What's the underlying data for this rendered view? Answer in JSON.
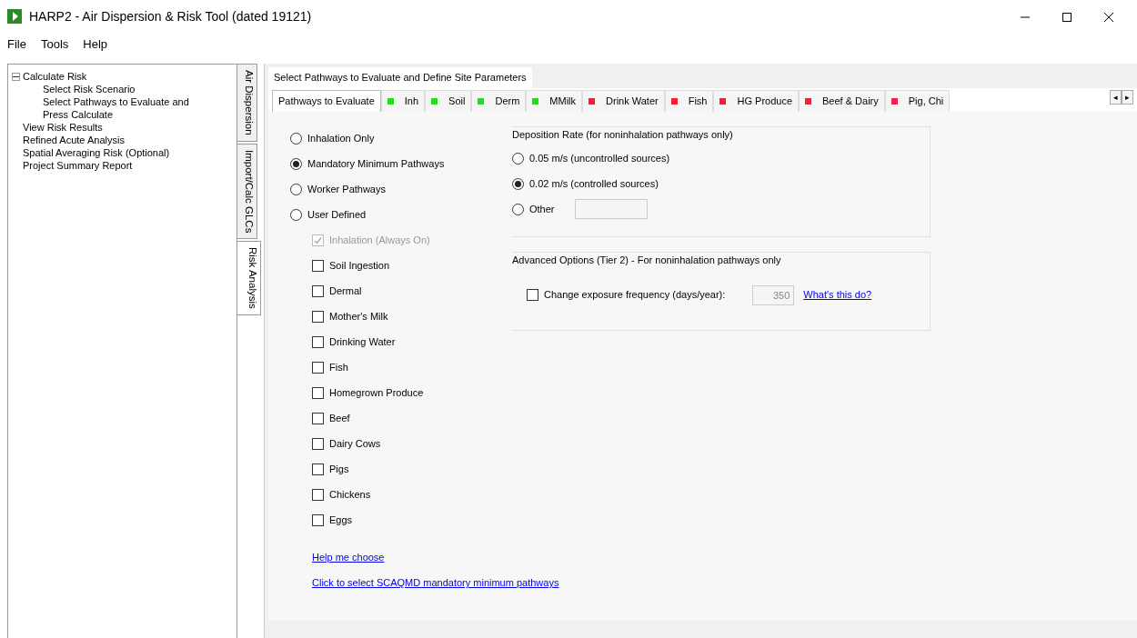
{
  "window": {
    "title": "HARP2 - Air Dispersion & Risk Tool (dated 19121)"
  },
  "menu": [
    "File",
    "Tools",
    "Help"
  ],
  "tree": [
    {
      "label": "Calculate Risk",
      "expanded": true,
      "children": [
        {
          "label": "Select Risk Scenario"
        },
        {
          "label": "Select Pathways to Evaluate and"
        },
        {
          "label": "Press Calculate"
        }
      ]
    },
    {
      "label": "View Risk Results"
    },
    {
      "label": "Refined Acute Analysis"
    },
    {
      "label": "Spatial Averaging Risk (Optional)"
    },
    {
      "label": "Project Summary Report"
    }
  ],
  "side_tabs": [
    {
      "label": "Air Dispersion",
      "selected": false
    },
    {
      "label": "Import/Calc GLCs",
      "selected": false
    },
    {
      "label": "Risk Analysis",
      "selected": true
    }
  ],
  "page_tab": {
    "label": "Select Pathways to Evaluate and Define Site Parameters"
  },
  "tabs": [
    {
      "label": "Pathways to Evaluate",
      "selected": true
    },
    {
      "label": "Inh",
      "selected": false,
      "color": "#22dd22"
    },
    {
      "label": "Soil",
      "selected": false,
      "color": "#22dd22"
    },
    {
      "label": "Derm",
      "selected": false,
      "color": "#22dd22"
    },
    {
      "label": "MMilk",
      "selected": false,
      "color": "#22dd22"
    },
    {
      "label": "Drink Water",
      "selected": false,
      "color": "#ee2233"
    },
    {
      "label": "Fish",
      "selected": false,
      "color": "#ee2233"
    },
    {
      "label": "HG Produce",
      "selected": false,
      "color": "#ee2233"
    },
    {
      "label": "Beef & Dairy",
      "selected": false,
      "color": "#ee2233"
    },
    {
      "label": "Pig, Chi",
      "selected": false,
      "color": "#ee2255"
    }
  ],
  "scroll_buttons": [
    "◂",
    "▸"
  ],
  "pathway_modes": [
    {
      "label": "Inhalation Only",
      "selected": false
    },
    {
      "label": "Mandatory Minimum Pathways",
      "selected": true
    },
    {
      "label": "Worker Pathways",
      "selected": false
    },
    {
      "label": "User Defined",
      "selected": false
    }
  ],
  "pathways": [
    {
      "label": "Inhalation (Always On)",
      "checked": true,
      "disabled": true
    },
    {
      "label": "Soil Ingestion",
      "checked": false,
      "disabled": false
    },
    {
      "label": "Dermal",
      "checked": false,
      "disabled": false
    },
    {
      "label": "Mother's Milk",
      "checked": false,
      "disabled": false
    },
    {
      "label": "Drinking Water",
      "checked": false,
      "disabled": false
    },
    {
      "label": "Fish",
      "checked": false,
      "disabled": false
    },
    {
      "label": "Homegrown Produce",
      "checked": false,
      "disabled": false
    },
    {
      "label": "Beef",
      "checked": false,
      "disabled": false
    },
    {
      "label": "Dairy Cows",
      "checked": false,
      "disabled": false
    },
    {
      "label": "Pigs",
      "checked": false,
      "disabled": false
    },
    {
      "label": "Chickens",
      "checked": false,
      "disabled": false
    },
    {
      "label": "Eggs",
      "checked": false,
      "disabled": false
    }
  ],
  "links": [
    "Help me choose",
    "Click to select SCAQMD mandatory minimum pathways"
  ],
  "deposition": {
    "title": "Deposition Rate (for noninhalation pathways only)",
    "options": [
      {
        "label": "0.05 m/s (uncontrolled sources)",
        "selected": false
      },
      {
        "label": "0.02 m/s (controlled sources)",
        "selected": true
      },
      {
        "label": "Other",
        "selected": false
      }
    ]
  },
  "advanced": {
    "title": "Advanced Options (Tier 2) - For noninhalation pathways only",
    "checkbox": {
      "label": "Change exposure frequency (days/year):",
      "checked": false
    },
    "value": "350",
    "link": "What's this do?"
  }
}
